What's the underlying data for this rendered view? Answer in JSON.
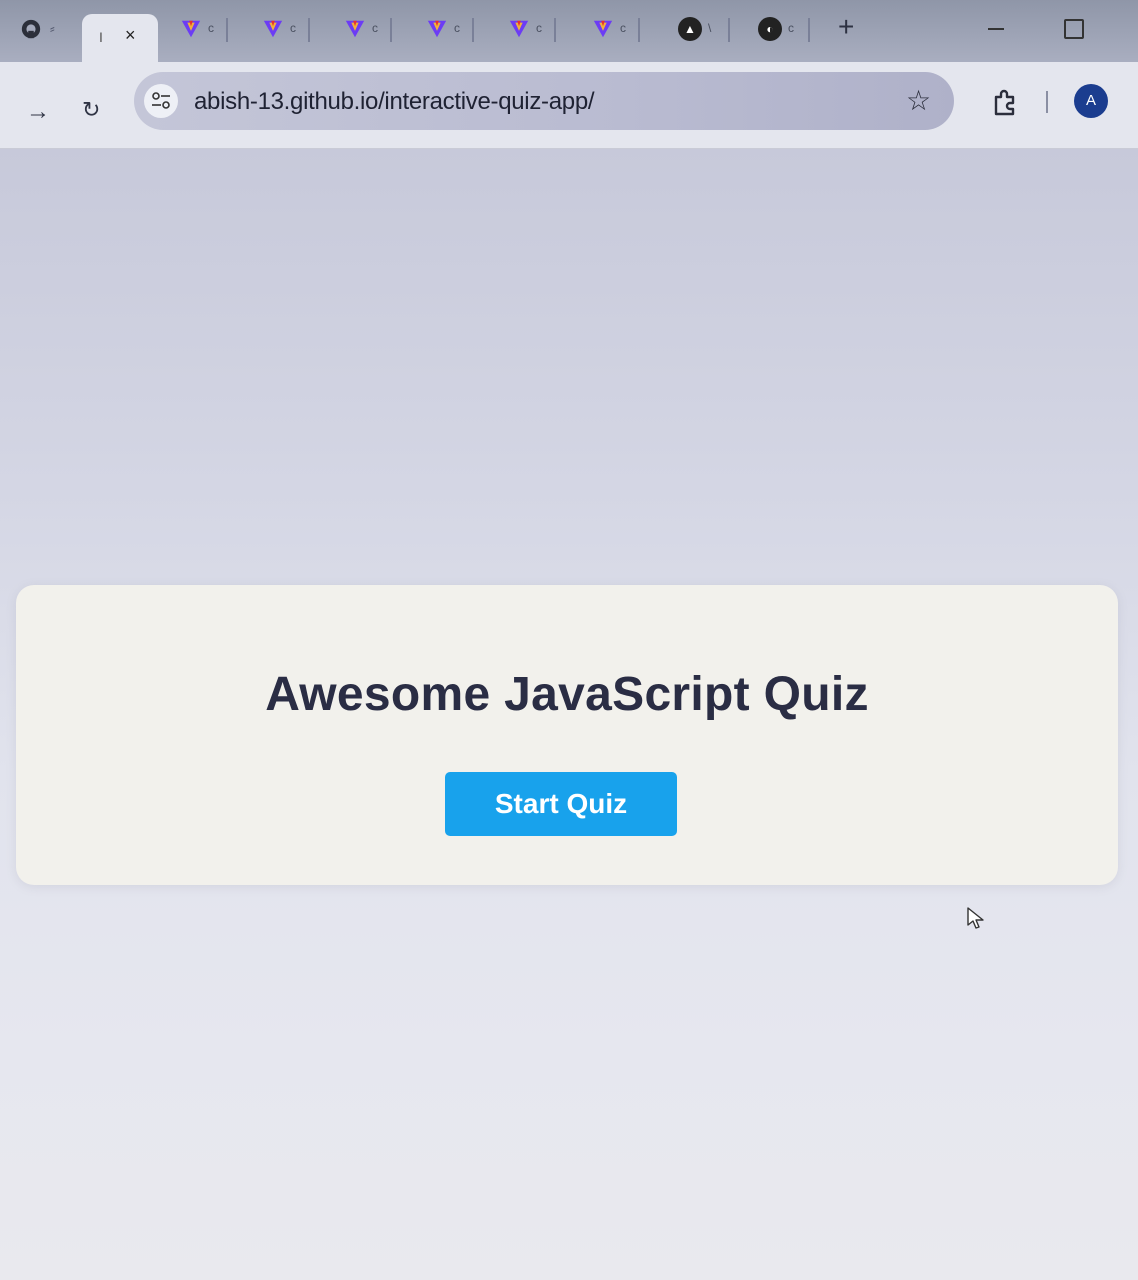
{
  "browser": {
    "tabs": {
      "github_suffix": "⸗",
      "active_label": "I",
      "active_close": "×",
      "vite_tab_suffix": "c",
      "circle_tab_1_suffix": "\\",
      "circle_tab_2_suffix": "c"
    },
    "new_tab": "+",
    "address_bar": {
      "url": "abish-13.github.io/interactive-quiz-app/"
    },
    "profile_initial": "A",
    "icons": [
      "github-icon",
      "vite-icon",
      "arc-icon",
      "globe-icon",
      "forward-arrow-icon",
      "reload-icon",
      "site-settings-icon",
      "star-icon",
      "extensions-icon"
    ]
  },
  "page": {
    "quiz_title": "Awesome JavaScript Quiz",
    "start_button_label": "Start Quiz"
  },
  "colors": {
    "accent": "#18a2ec",
    "title_text": "#2a2d44",
    "card_bg": "#f2f1ec",
    "vite_purple": "#6c3cf5",
    "vite_red": "#e8312f"
  }
}
